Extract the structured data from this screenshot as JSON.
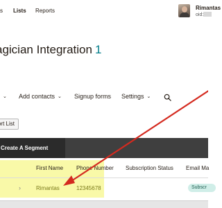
{
  "topnav": {
    "items": [
      {
        "label": "s"
      },
      {
        "label": "Lists"
      },
      {
        "label": "Reports"
      }
    ],
    "user": {
      "name": "Rimantas",
      "id_label": "oid:"
    }
  },
  "page": {
    "title": "agician Integration",
    "count": "1"
  },
  "subnav": {
    "items": [
      {
        "label": ""
      },
      {
        "label": "Add contacts"
      },
      {
        "label": "Signup forms"
      },
      {
        "label": "Settings"
      }
    ],
    "search_icon": "search-icon"
  },
  "toolbar": {
    "import_label": "ort List"
  },
  "segments": {
    "create_label": "Create A Segment"
  },
  "table": {
    "columns": [
      "First Name",
      "Phone Number",
      "Subscription Status",
      "Email Ma"
    ],
    "rows": [
      {
        "first_name": "Rimantas",
        "phone": "12345678",
        "status": "Subscr"
      }
    ]
  },
  "colors": {
    "accent": "#007c89",
    "highlight": "#f9f9a8",
    "arrow": "#d42a1f",
    "segment_bar": "#3f3f3f"
  }
}
